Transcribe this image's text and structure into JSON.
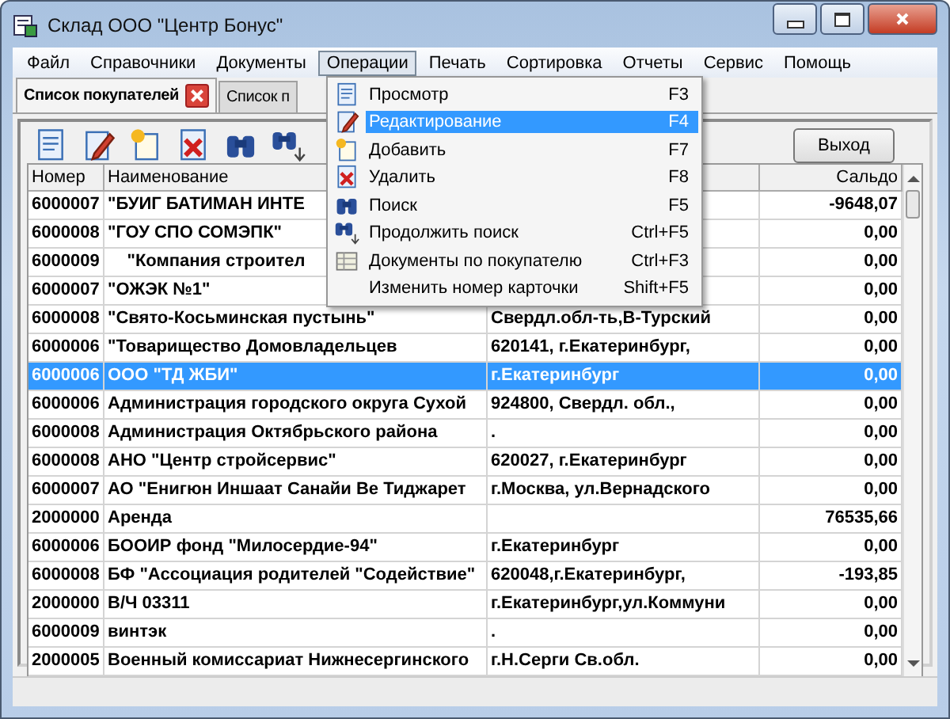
{
  "window": {
    "title": "Склад ООО \"Центр Бонус\""
  },
  "menu_bar": [
    {
      "label": "Файл",
      "selected": false
    },
    {
      "label": "Справочники",
      "selected": false
    },
    {
      "label": "Документы",
      "selected": false
    },
    {
      "label": "Операции",
      "selected": true
    },
    {
      "label": "Печать",
      "selected": false
    },
    {
      "label": "Сортировка",
      "selected": false
    },
    {
      "label": "Отчеты",
      "selected": false
    },
    {
      "label": "Сервис",
      "selected": false
    },
    {
      "label": "Помощь",
      "selected": false
    }
  ],
  "tabs": [
    {
      "label": "Список покупателей",
      "selected": true,
      "closable": true
    },
    {
      "label": "Список п",
      "selected": false,
      "closable": false
    }
  ],
  "toolbar": [
    {
      "kind": "view"
    },
    {
      "kind": "edit"
    },
    {
      "kind": "add"
    },
    {
      "kind": "delete"
    },
    {
      "kind": "search"
    },
    {
      "kind": "search-next"
    }
  ],
  "exit_button": "Выход",
  "table": {
    "columns": [
      "Номер",
      "Наименование",
      "Сальдо"
    ],
    "rows": [
      {
        "number": "6000007",
        "name": "\"БУИГ БАТИМАН ИНТЕ",
        "address": "",
        "balance": "-9648,07",
        "selected": false
      },
      {
        "number": "6000008",
        "name": "\"ГОУ СПО СОМЭПК\"",
        "address": "",
        "balance": "0,00",
        "selected": false
      },
      {
        "number": "6000009",
        "name": "    \"Компания строител",
        "address": "",
        "balance": "0,00",
        "selected": false
      },
      {
        "number": "6000007",
        "name": "\"ОЖЭК №1\"",
        "address": "",
        "balance": "0,00",
        "selected": false
      },
      {
        "number": "6000008",
        "name": "\"Свято-Косьминская пустынь\"",
        "address": "Свердл.обл-ть,В-Турский",
        "balance": "0,00",
        "selected": false
      },
      {
        "number": "6000006",
        "name": "\"Товарищество Домовладельцев",
        "address": "620141, г.Екатеринбург,",
        "balance": "0,00",
        "selected": false
      },
      {
        "number": "6000006",
        "name": "ООО \"ТД ЖБИ\"",
        "address": "г.Екатеринбург",
        "balance": "0,00",
        "selected": true
      },
      {
        "number": "6000006",
        "name": "Администрация городского округа Сухой",
        "address": "924800, Свердл. обл.,",
        "balance": "0,00",
        "selected": false
      },
      {
        "number": "6000008",
        "name": "Администрация Октябрьского района",
        "address": ".",
        "balance": "0,00",
        "selected": false
      },
      {
        "number": "6000008",
        "name": "АНО \"Центр стройсервис\"",
        "address": "620027, г.Екатеринбург",
        "balance": "0,00",
        "selected": false
      },
      {
        "number": "6000007",
        "name": "АО \"Енигюн Иншаат Санайи Ве Тиджарет",
        "address": "г.Москва, ул.Вернадского",
        "balance": "0,00",
        "selected": false
      },
      {
        "number": "2000000",
        "name": "Аренда",
        "address": "",
        "balance": "76535,66",
        "selected": false
      },
      {
        "number": "6000006",
        "name": "БООИР фонд \"Милосердие-94\"",
        "address": "г.Екатеринбург",
        "balance": "0,00",
        "selected": false
      },
      {
        "number": "6000008",
        "name": "БФ \"Ассоциация родителей \"Содействие\"",
        "address": "620048,г.Екатеринбург,",
        "balance": "-193,85",
        "selected": false
      },
      {
        "number": "2000000",
        "name": "В/Ч 03311",
        "address": "г.Екатеринбург,ул.Коммуни",
        "balance": "0,00",
        "selected": false
      },
      {
        "number": "6000009",
        "name": "винтэк",
        "address": ".",
        "balance": "0,00",
        "selected": false
      },
      {
        "number": "2000005",
        "name": "Военный комиссариат Нижнесергинского",
        "address": "г.Н.Серги Св.обл.",
        "balance": "0,00",
        "selected": false
      }
    ]
  },
  "dropdown_menu": [
    {
      "kind": "view",
      "label": "Просмотр",
      "shortcut": "F3",
      "selected": false
    },
    {
      "kind": "edit",
      "label": "Редактирование",
      "shortcut": "F4",
      "selected": true
    },
    {
      "kind": "add",
      "label": "Добавить",
      "shortcut": "F7",
      "selected": false
    },
    {
      "kind": "delete",
      "label": "Удалить",
      "shortcut": "F8",
      "selected": false
    },
    {
      "kind": "search",
      "label": "Поиск",
      "shortcut": "F5",
      "selected": false
    },
    {
      "kind": "search-next",
      "label": "Продолжить поиск",
      "shortcut": "Ctrl+F5",
      "selected": false
    },
    {
      "kind": "documents",
      "label": "Документы по покупателю",
      "shortcut": "Ctrl+F3",
      "selected": false
    },
    {
      "kind": "none",
      "label": "Изменить номер карточки",
      "shortcut": "Shift+F5",
      "selected": false
    }
  ]
}
